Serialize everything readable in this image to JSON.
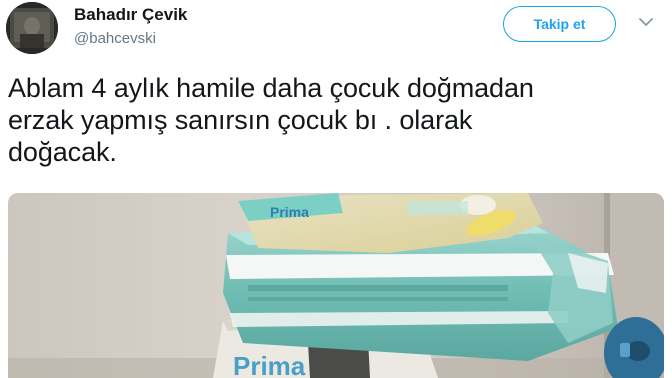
{
  "author": {
    "display_name": "Bahadır Çevik",
    "username": "@bahcevski",
    "avatar_icon": "user-avatar"
  },
  "follow_button": {
    "label": "Takip et",
    "color": "#1da1f2"
  },
  "more_menu": {
    "icon": "chevron-down-icon"
  },
  "tweet": {
    "lines": [
      "Ablam 4 aylık hamile daha çocuk doğmadan",
      "erzak yapmış sanırsın çocuk bı . olarak",
      "doğacak."
    ]
  },
  "media": {
    "package_label": "Prima"
  },
  "colors": {
    "text": "#14171a",
    "secondary": "#657786",
    "accent": "#1da1f2"
  }
}
